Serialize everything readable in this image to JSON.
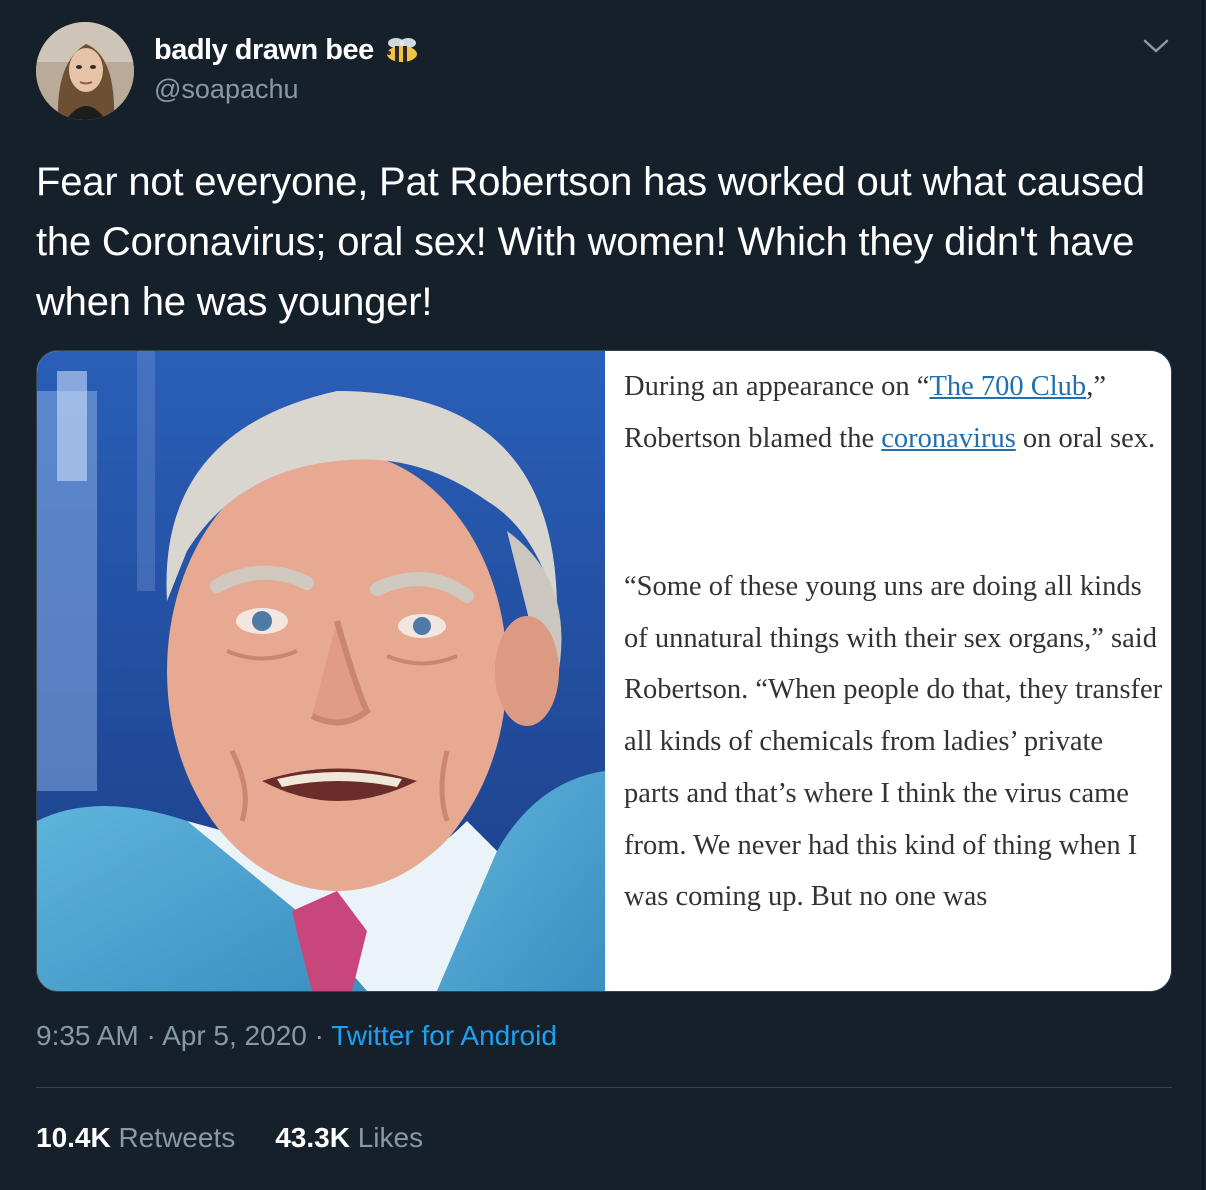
{
  "author": {
    "display_name": "badly drawn bee",
    "handle": "@soapachu",
    "badge_icon": "bee-icon"
  },
  "tweet": {
    "text": "Fear not everyone, Pat Robertson has worked out what caused the Coronavirus; oral sex! With women! Which they didn't have when he was younger!"
  },
  "article_screenshot": {
    "p1_before_link1": "During an appearance on “",
    "link1": "The 700 Club",
    "p1_after_link1": ",” Robertson blamed the ",
    "link2": "coronavirus",
    "p1_after_link2": " on oral sex.",
    "p2": "“Some of these young uns are doing all kinds of unnatural things with their sex organs,” said Robertson. “When people do that, they transfer all kinds of chemicals from ladies’ private parts and that’s where I think the virus came from. We never had this kind of thing when I was coming up. But no one was"
  },
  "meta": {
    "time": "9:35 AM",
    "separator": " · ",
    "date": "Apr 5, 2020",
    "source": "Twitter for Android"
  },
  "stats": {
    "retweets_count": "10.4K",
    "retweets_label": "Retweets",
    "likes_count": "43.3K",
    "likes_label": "Likes"
  },
  "colors": {
    "background": "#15202b",
    "secondary_text": "#8899a6",
    "accent": "#1da1f2",
    "border": "#38444d",
    "link": "#1f6fb3"
  }
}
